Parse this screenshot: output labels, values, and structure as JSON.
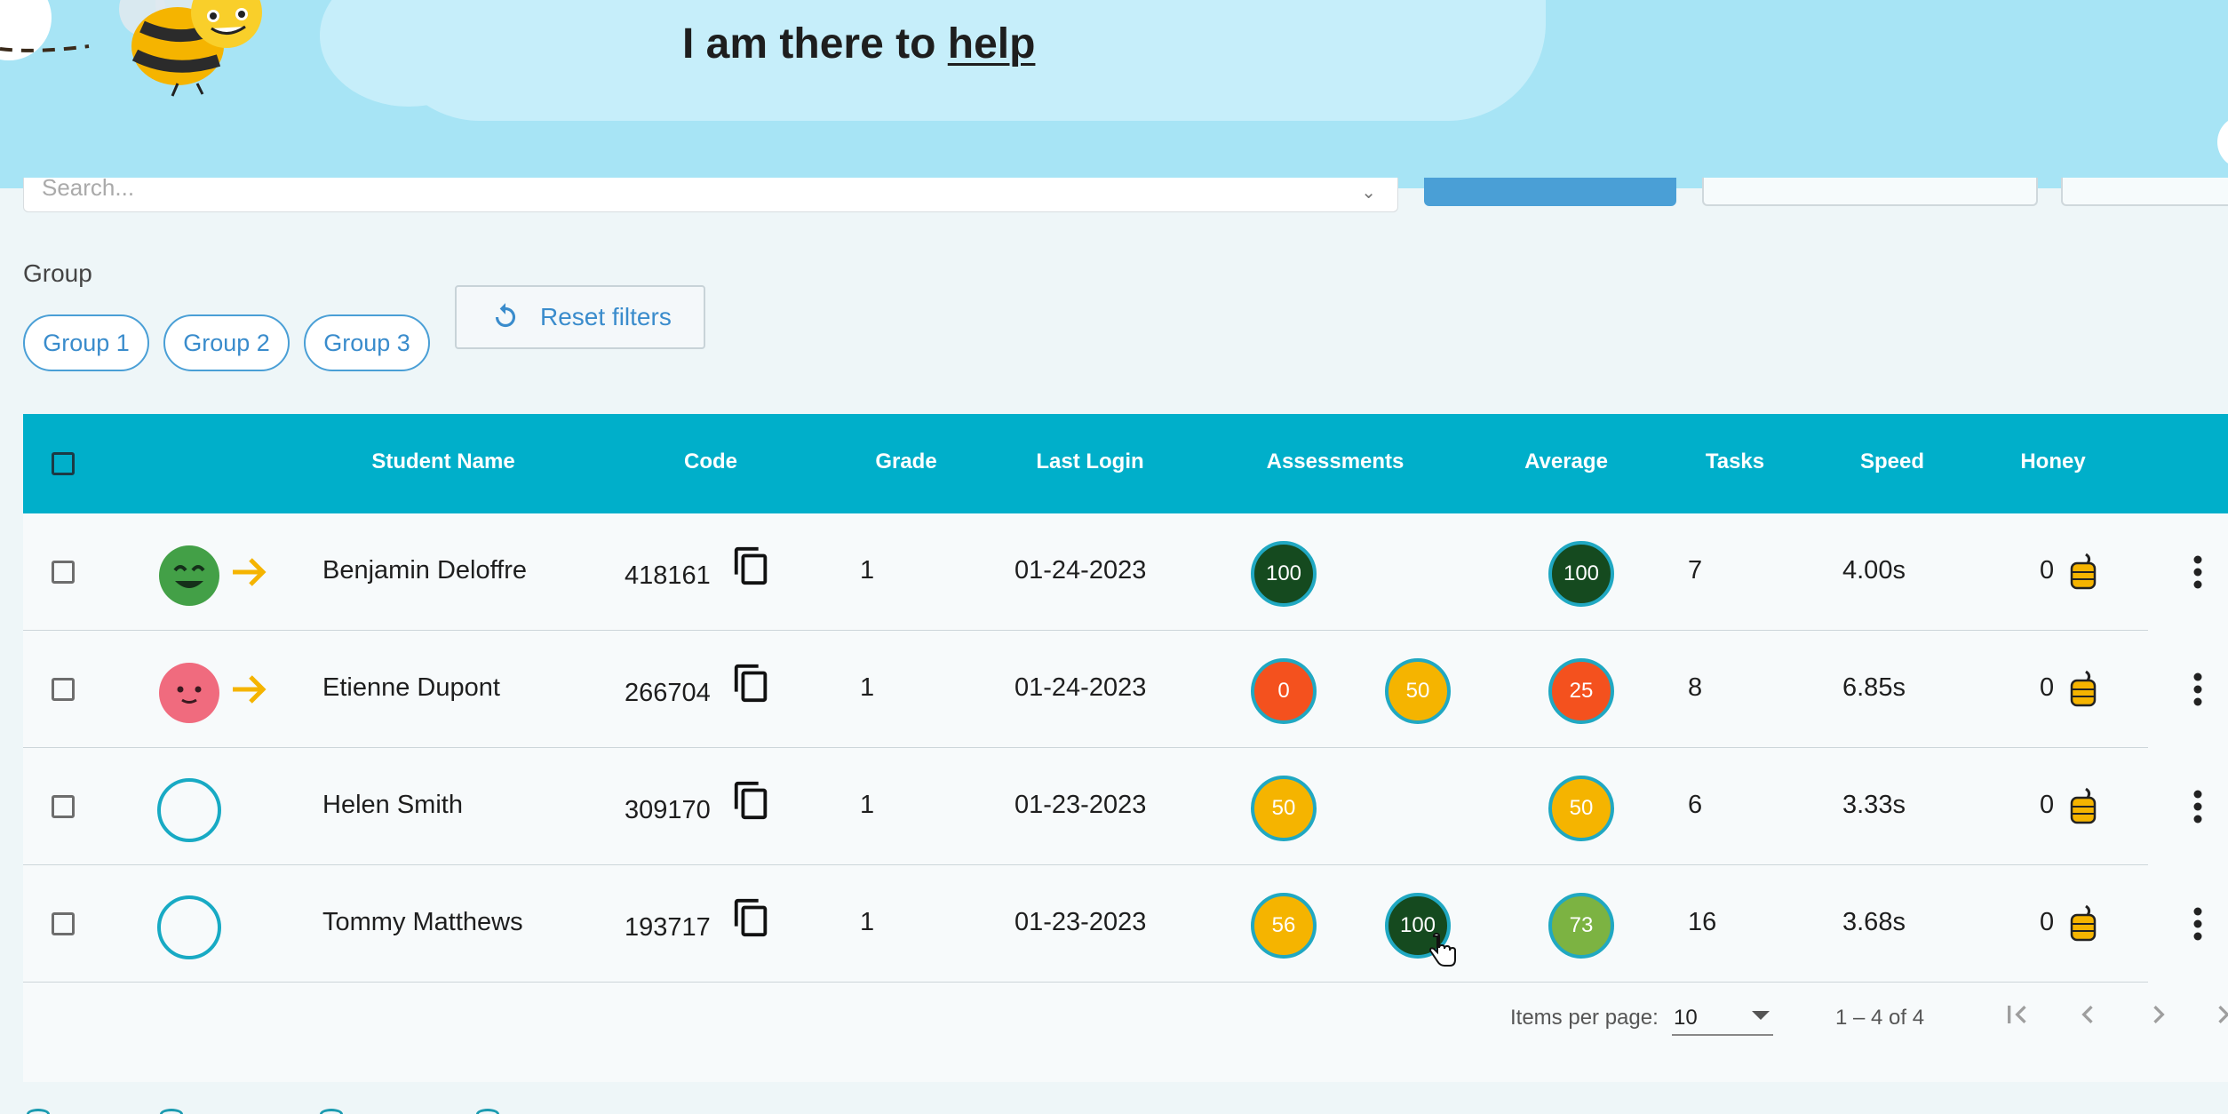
{
  "banner": {
    "text_prefix": "I am there to",
    "text_link": "help"
  },
  "toolbar": {
    "search_placeholder": "Search..."
  },
  "filters": {
    "group_label": "Group",
    "groups": [
      "Group 1",
      "Group 2",
      "Group 3"
    ],
    "reset_label": "Reset filters"
  },
  "table": {
    "headers": {
      "student_name": "Student Name",
      "code": "Code",
      "grade": "Grade",
      "last_login": "Last Login",
      "assessments": "Assessments",
      "average": "Average",
      "tasks": "Tasks",
      "speed": "Speed",
      "honey": "Honey"
    },
    "rows": [
      {
        "name": "Benjamin Deloffre",
        "avatar": "smile-happy",
        "code": "418161",
        "grade": "1",
        "last_login": "01-24-2023",
        "assessment_1": "100",
        "assessment_2": "",
        "average": "100",
        "tasks": "7",
        "speed": "4.00s",
        "honey": "0"
      },
      {
        "name": "Etienne Dupont",
        "avatar": "smile-neutral",
        "code": "266704",
        "grade": "1",
        "last_login": "01-24-2023",
        "assessment_1": "0",
        "assessment_2": "50",
        "average": "25",
        "tasks": "8",
        "speed": "6.85s",
        "honey": "0"
      },
      {
        "name": "Helen Smith",
        "avatar": "empty",
        "code": "309170",
        "grade": "1",
        "last_login": "01-23-2023",
        "assessment_1": "50",
        "assessment_2": "",
        "average": "50",
        "tasks": "6",
        "speed": "3.33s",
        "honey": "0"
      },
      {
        "name": "Tommy Matthews",
        "avatar": "empty",
        "code": "193717",
        "grade": "1",
        "last_login": "01-23-2023",
        "assessment_1": "56",
        "assessment_2": "100",
        "average": "73",
        "tasks": "16",
        "speed": "3.68s",
        "honey": "0"
      }
    ]
  },
  "pagination": {
    "items_per_page_label": "Items per page:",
    "items_per_page_value": "10",
    "range": "1 – 4 of 4"
  },
  "colors": {
    "header": "#00afca",
    "score_100": "#154a1f",
    "score_73": "#7cb342",
    "score_50": "#f5b400",
    "score_25": "#f4511e",
    "accent_blue": "#3a8ccc"
  }
}
